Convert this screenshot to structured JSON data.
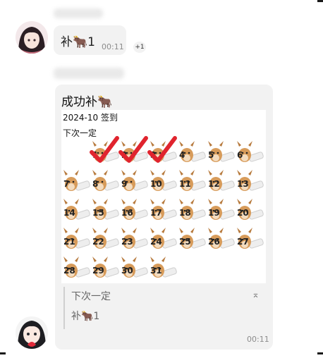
{
  "chat": {
    "message1": {
      "text": "补🐂1",
      "time": "00:11",
      "reaction": "+1"
    },
    "message2": {
      "title": "成功补🐂",
      "checkin_header": "2024-10 签到",
      "subtitle": "下次一定",
      "days": [
        "1",
        "2",
        "3",
        "4",
        "5",
        "6",
        "7",
        "8",
        "9",
        "10",
        "11",
        "12",
        "13",
        "14",
        "15",
        "16",
        "17",
        "18",
        "19",
        "20",
        "21",
        "22",
        "23",
        "24",
        "25",
        "26",
        "27",
        "28",
        "29",
        "30",
        "31"
      ],
      "checked_days": [
        1,
        2,
        3
      ],
      "quote": {
        "line1": "下次一定",
        "line2": "补🐂1",
        "collapse_glyph": "⌅"
      },
      "time": "00:11"
    }
  },
  "colors": {
    "bubble": "#f2f2f2",
    "check": "#e0242e",
    "time_text": "#8c8c8c"
  }
}
